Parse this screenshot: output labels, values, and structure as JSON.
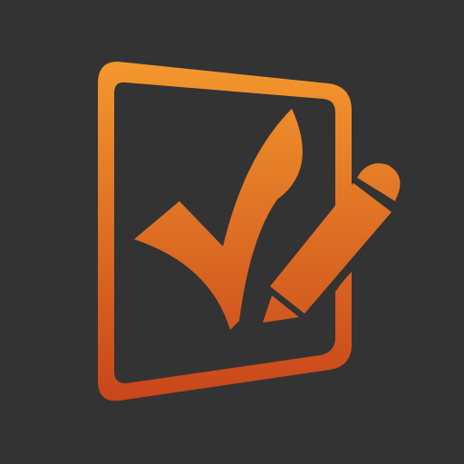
{
  "icon": {
    "semantic": "checklist-pencil-icon",
    "background_color": "#333333",
    "gradient_top": "#F4992E",
    "gradient_bottom": "#C8451A"
  }
}
